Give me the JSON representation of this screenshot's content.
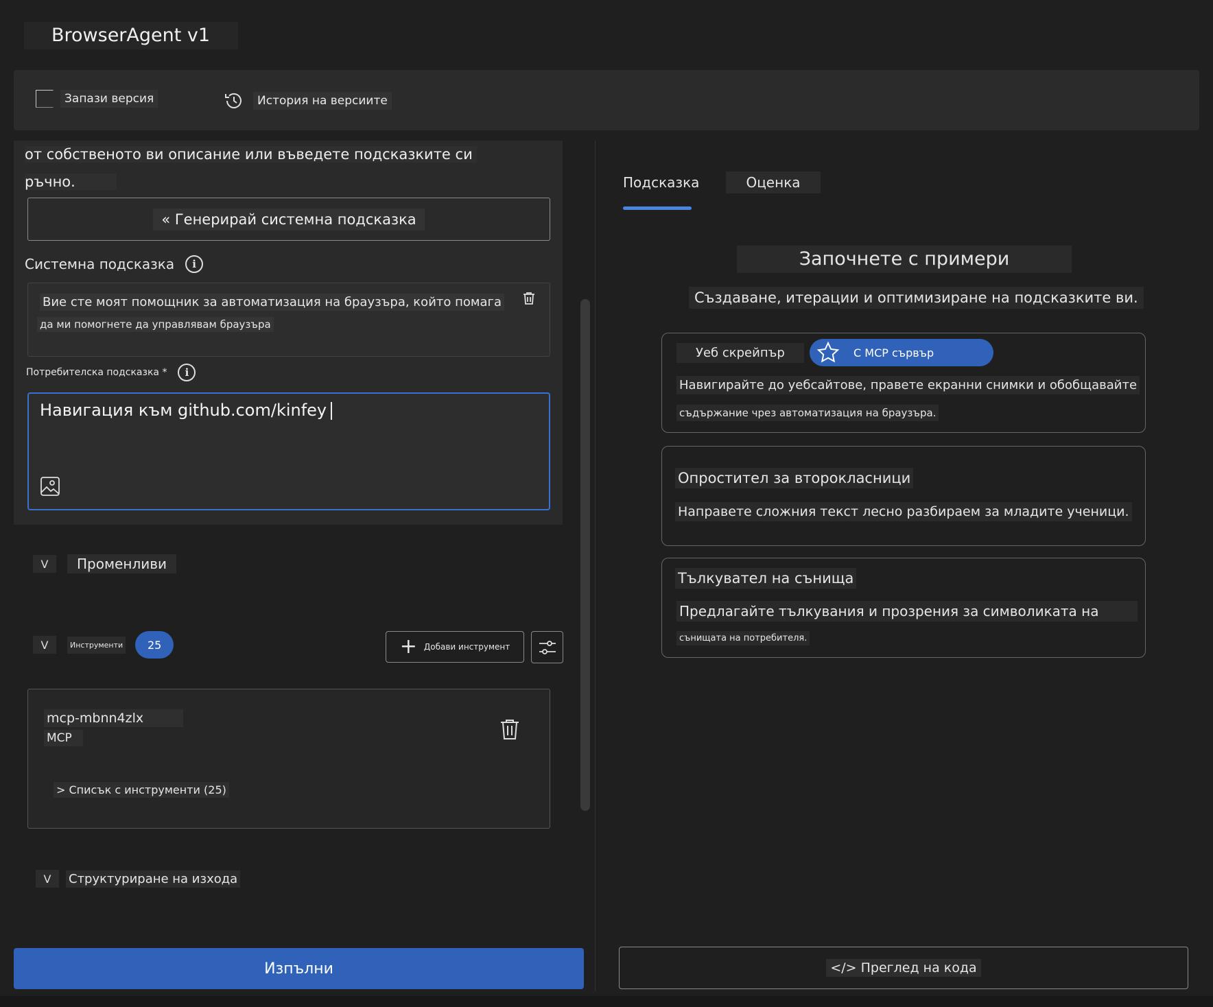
{
  "app": {
    "title": "BrowserAgent v1"
  },
  "toolbar": {
    "save_label": "Запази версия",
    "history_label": "История на версиите"
  },
  "left": {
    "intro_line1": "от собственото ви описание или въведете подсказките си",
    "intro_line2": "ръчно.",
    "generate_label": "« Генерирай системна подсказка",
    "system_label": "Системна подсказка",
    "system_text_line1": "Вие сте моят помощник за автоматизация на браузъра, който помага",
    "system_text_line2": "да ми помогнете да управлявам браузъра",
    "user_label": "Потребителска подсказка *",
    "user_input": "Навигация към github.com/kinfey",
    "variables_label": "Променливи",
    "tools_label": "Инструменти",
    "tools_count": "25",
    "add_tool_label": "Добави инструмент",
    "tool_card": {
      "name": "mcp-mbnn4zlx",
      "type": "MCP",
      "list_label": "> Списък с инструменти (25)"
    },
    "output_label": "Структуриране на изхода",
    "chevron": "V",
    "run_label": "Изпълни"
  },
  "right": {
    "tabs": [
      {
        "label": "Подсказка"
      },
      {
        "label": "Оценка"
      }
    ],
    "examples_title": "Започнете с примери",
    "examples_subtitle": "Създаване, итерации и оптимизиране на подсказките ви.",
    "cards": [
      {
        "chip_web": "Уеб скрейпър",
        "chip_mcp": "С МСР сървър",
        "desc_line1": "Навигирайте до уебсайтове, правете екранни снимки и обобщавайте",
        "desc_line2": "съдържание чрез автоматизация на браузъра."
      },
      {
        "title": "Опростител за второкласници",
        "desc": "Направете сложния текст лесно разбираем за младите ученици."
      },
      {
        "title": "Тълкувател на сънища",
        "desc_line1": "Предлагайте тълкувания и прозрения за символиката на",
        "desc_line2": "сънищата на потребителя."
      }
    ],
    "code_label": "</> Преглед на кода"
  },
  "colors": {
    "accent": "#2f62b8",
    "background": "#1f1f1f",
    "input_focus": "#3b6fd1"
  },
  "icons": [
    "save-icon",
    "history-icon",
    "info-icon",
    "trash-icon",
    "image-icon",
    "plus-icon",
    "filter-icon",
    "star-icon"
  ]
}
